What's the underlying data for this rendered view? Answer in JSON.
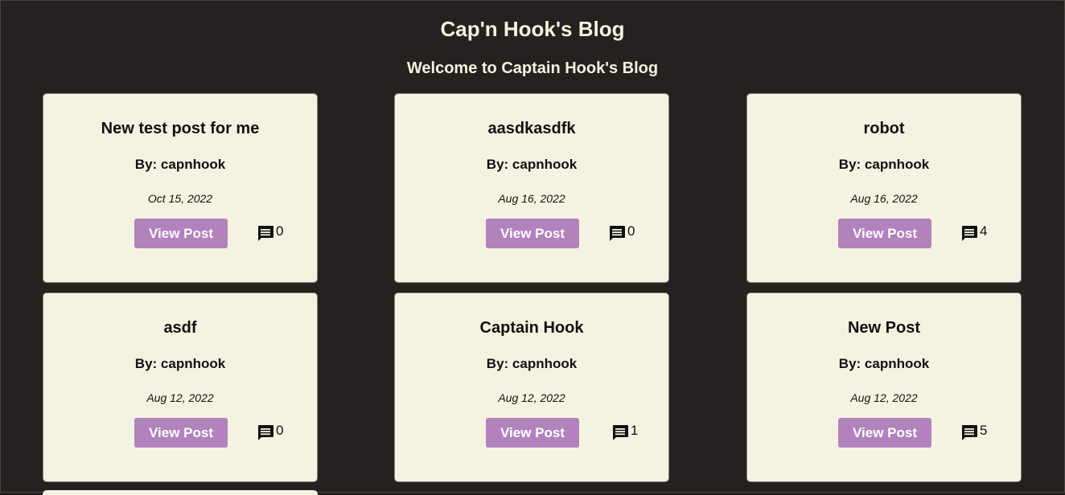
{
  "site": {
    "title": "Cap'n Hook's Blog",
    "welcome": "Welcome to Captain Hook's Blog"
  },
  "colors": {
    "background": "#252120",
    "card": "#f4f3e1",
    "button": "#b282bd",
    "heading_text": "#f4f1df"
  },
  "icons": {
    "comment": "comment-icon"
  },
  "posts": [
    {
      "title": "New test post for me",
      "author": "By: capnhook",
      "date": "Oct 15, 2022",
      "button_label": "View Post",
      "comment_count": "0"
    },
    {
      "title": "aasdkasdfk",
      "author": "By: capnhook",
      "date": "Aug 16, 2022",
      "button_label": "View Post",
      "comment_count": "0"
    },
    {
      "title": "robot",
      "author": "By: capnhook",
      "date": "Aug 16, 2022",
      "button_label": "View Post",
      "comment_count": "4"
    },
    {
      "title": "asdf",
      "author": "By: capnhook",
      "date": "Aug 12, 2022",
      "button_label": "View Post",
      "comment_count": "0"
    },
    {
      "title": "Captain Hook",
      "author": "By: capnhook",
      "date": "Aug 12, 2022",
      "button_label": "View Post",
      "comment_count": "1"
    },
    {
      "title": "New Post",
      "author": "By: capnhook",
      "date": "Aug 12, 2022",
      "button_label": "View Post",
      "comment_count": "5"
    }
  ]
}
